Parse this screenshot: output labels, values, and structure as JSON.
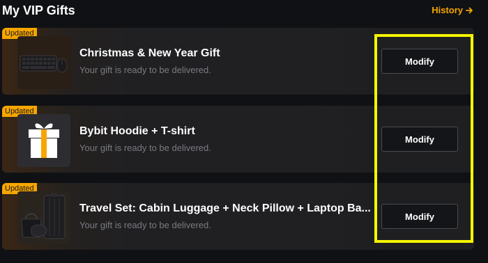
{
  "header": {
    "title": "My VIP Gifts",
    "history_label": "History"
  },
  "colors": {
    "accent": "#f7a600",
    "highlight": "#f5f500",
    "background": "#101114",
    "card": "#1f1f22"
  },
  "gifts": [
    {
      "badge": "Updated",
      "title": "Christmas & New Year Gift",
      "status": "Your gift is ready to be delivered.",
      "button": "Modify",
      "image": "keyboard-mouse-image"
    },
    {
      "badge": "Updated",
      "title": "Bybit Hoodie + T-shirt",
      "status": "Your gift is ready to be delivered.",
      "button": "Modify",
      "image": "gift-box-icon"
    },
    {
      "badge": "Updated",
      "title": "Travel Set: Cabin Luggage + Neck Pillow + Laptop Ba...",
      "status": "Your gift is ready to be delivered.",
      "button": "Modify",
      "image": "travel-set-image"
    }
  ]
}
